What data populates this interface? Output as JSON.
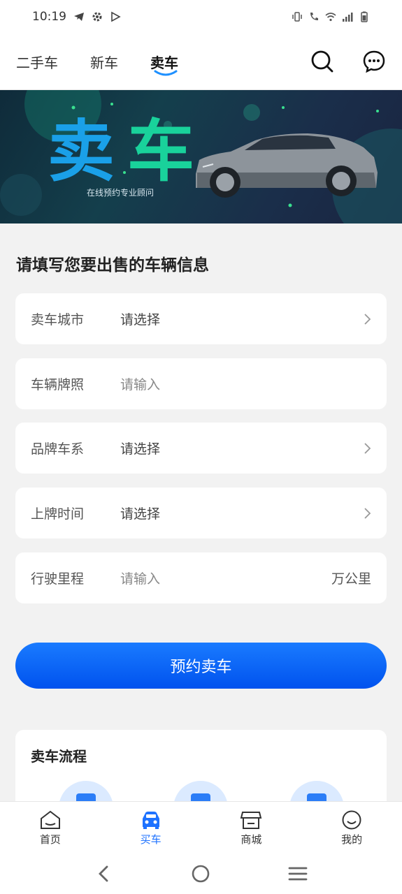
{
  "status_bar": {
    "time": "10:19",
    "left_icons": [
      "telegram-icon",
      "gear-icon",
      "play-store-icon"
    ],
    "right_icons": [
      "vibrate-icon",
      "wifi-call-icon",
      "wifi-icon",
      "signal-icon",
      "battery-icon"
    ]
  },
  "top_nav": {
    "tabs": [
      {
        "label": "二手车"
      },
      {
        "label": "新车"
      },
      {
        "label": "卖车"
      }
    ],
    "active_tab": "卖车",
    "actions": [
      "search-icon",
      "message-icon"
    ]
  },
  "banner": {
    "title_part1": "卖",
    "title_part2": "车",
    "subtitle": "在线预约专业顾问"
  },
  "form": {
    "title": "请填写您要出售的车辆信息",
    "fields": [
      {
        "label": "卖车城市",
        "value": "请选择",
        "has_chevron": true
      },
      {
        "label": "车辆牌照",
        "value": "请输入",
        "has_chevron": false
      },
      {
        "label": "品牌车系",
        "value": "请选择",
        "has_chevron": true
      },
      {
        "label": "上牌时间",
        "value": "请选择",
        "has_chevron": true
      },
      {
        "label": "行驶里程",
        "value": "请输入",
        "unit": "万公里"
      }
    ],
    "submit_label": "预约卖车"
  },
  "process": {
    "title": "卖车流程"
  },
  "tab_bar": {
    "items": [
      {
        "label": "首页",
        "icon": "home-icon"
      },
      {
        "label": "买车",
        "icon": "car-icon"
      },
      {
        "label": "商城",
        "icon": "store-icon"
      },
      {
        "label": "我的",
        "icon": "profile-icon"
      }
    ],
    "active": "买车"
  },
  "colors": {
    "accent": "#1e72ff",
    "button_gradient_top": "#1a7bff",
    "button_gradient_bottom": "#0052ee",
    "banner_title_blue": "#1aa0e8",
    "banner_title_green": "#19d29b"
  }
}
